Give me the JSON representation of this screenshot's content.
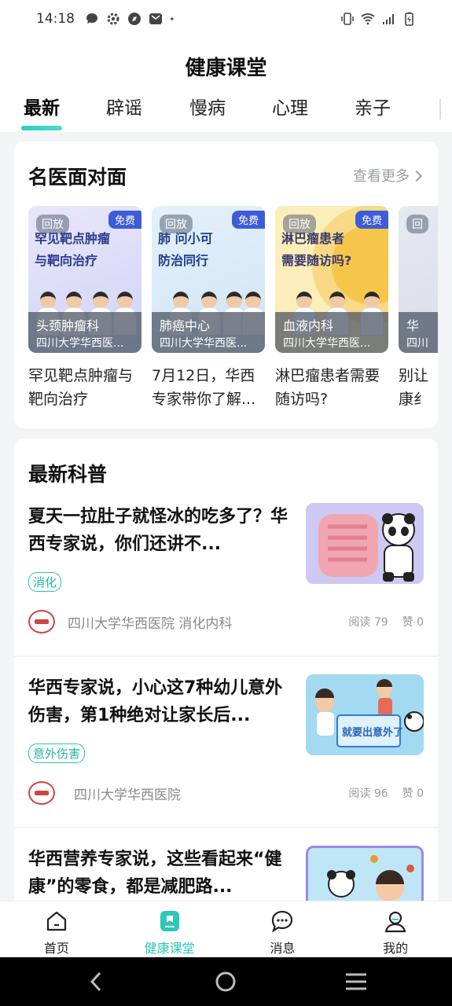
{
  "status_bar": {
    "time": "14:18",
    "left_icons": [
      "chat-icon",
      "gear-icon",
      "compass-icon",
      "mail-icon",
      "dot-icon"
    ],
    "right_icons": [
      "vibrate-icon",
      "wifi-icon",
      "signal-icon",
      "battery-icon"
    ]
  },
  "header": {
    "title": "健康课堂",
    "tabs": [
      {
        "label": "最新",
        "active": true
      },
      {
        "label": "辟谣",
        "active": false
      },
      {
        "label": "慢病",
        "active": false
      },
      {
        "label": "心理",
        "active": false
      },
      {
        "label": "亲子",
        "active": false
      }
    ]
  },
  "famous_doctors": {
    "title": "名医面对面",
    "more": "查看更多",
    "items": [
      {
        "replay": "回放",
        "free": "免费",
        "poster_text": [
          "罕见靶点肿瘤",
          "与靶向治疗"
        ],
        "dept": "头颈肿瘤科",
        "hospital": "四川大学华西医...",
        "title": "罕见靶点肿瘤与靶向治疗"
      },
      {
        "replay": "回放",
        "free": "免费",
        "poster_text": [
          "肺 问小可",
          "防治同行"
        ],
        "dept": "肺癌中心",
        "hospital": "四川大学华西医...",
        "title": "7月12日，华西专家带你了解..."
      },
      {
        "replay": "回放",
        "free": "免费",
        "poster_text": [
          "淋巴瘤患者",
          "需要随访吗?"
        ],
        "dept": "血液内科",
        "hospital": "四川大学华西医...",
        "title": "淋巴瘤患者需要随访吗?"
      },
      {
        "replay": "回",
        "free": "",
        "poster_text": [],
        "dept": "华",
        "hospital": "四川",
        "title": "别让康纟"
      }
    ]
  },
  "science": {
    "title": "最新科普",
    "articles": [
      {
        "title": "夏天一拉肚子就怪冰的吃多了？华西专家说，你们还讲不...",
        "tag": "消化",
        "source": "四川大学华西医院  消化内科",
        "reads_label": "阅读 79",
        "likes_label": "赞 0"
      },
      {
        "title": "华西专家说，小心这7种幼儿意外伤害，第1种绝对让家长后...",
        "tag": "意外伤害",
        "source": "四川大学华西医院",
        "reads_label": "阅读 96",
        "likes_label": "赞 0"
      },
      {
        "title": "华西营养专家说，这些看起来“健康”的零食，都是减肥路..."
      }
    ],
    "second_image_text": "就要出意外了"
  },
  "bottom_nav": [
    {
      "label": "首页",
      "icon": "home-icon",
      "active": false
    },
    {
      "label": "健康课堂",
      "icon": "book-icon",
      "active": true
    },
    {
      "label": "消息",
      "icon": "message-icon",
      "active": false
    },
    {
      "label": "我的",
      "icon": "user-icon",
      "active": false
    }
  ],
  "system_nav": [
    "back-icon",
    "home-circle-icon",
    "menu-icon"
  ],
  "colors": {
    "accent": "#2cc7b8",
    "free_badge": "#3d5cd6",
    "background": "#f2f4f6"
  }
}
